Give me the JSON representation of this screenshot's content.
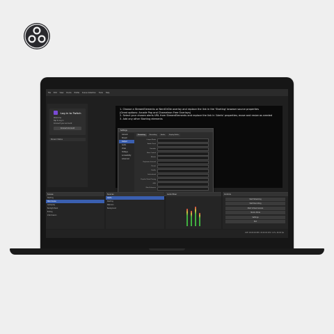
{
  "menubar": [
    "File",
    "Edit",
    "View",
    "Docks",
    "Profile",
    "Scene Collection",
    "Tools",
    "Help"
  ],
  "twitch": {
    "title": "Log in to Twitch",
    "lines": [
      "Welcome",
      "Tap to log in",
      "Connect your account"
    ],
    "button": "Connect Account"
  },
  "status_row": "Stream Status",
  "instructions": [
    "1. Choose a StreamElements or NerdOrDie overlay and replace the link in the 'Starting' browser source properties",
    "(Great options: Arcade Pop and Chameleon Free Overlays)",
    "2. Select your chosen alerts URL from StreamElements and replace the link in 'Alerts' properties; move and resize as needed",
    "3. Add any other Starting elements"
  ],
  "dialog": {
    "title": "Settings",
    "nav": [
      "General",
      "Stream",
      "Output",
      "Audio",
      "Video",
      "Hotkeys",
      "Accessibility",
      "Advanced"
    ],
    "nav_selected": 2,
    "tabs": [
      "Streaming",
      "Recording",
      "Audio",
      "Replay Buffer"
    ],
    "tab_active": 0,
    "fields": [
      "Output Mode",
      "Audio Track",
      "Encoder",
      "Rate Control",
      "Bitrate",
      "Keyframe Interval",
      "Preset",
      "Profile",
      "Look-ahead",
      "Psycho Visual Tuning",
      "GPU",
      "Max B-frames"
    ]
  },
  "scenes": {
    "header": "Scenes",
    "items": [
      "Starting",
      "Main Scene",
      "Gameplay",
      "Be Right Back",
      "Ending",
      "Intermission"
    ],
    "selected": 1
  },
  "sources": {
    "header": "Sources",
    "items": [
      "Alerts",
      "Starting",
      "Webcam",
      "Background"
    ],
    "selected": 0
  },
  "mixer": {
    "header": "Audio Mixer",
    "levels": [
      0.62,
      0.55,
      0.7,
      0.48
    ]
  },
  "controls": {
    "header": "Controls",
    "buttons": [
      "Start Streaming",
      "Start Recording",
      "Start Virtual Camera",
      "Studio Mode",
      "Settings",
      "Exit"
    ]
  },
  "statusbar": {
    "text": "LIVE: 00:00:00   REC: 00:00:00   CPU: 1.2%, 60.00 fps"
  }
}
